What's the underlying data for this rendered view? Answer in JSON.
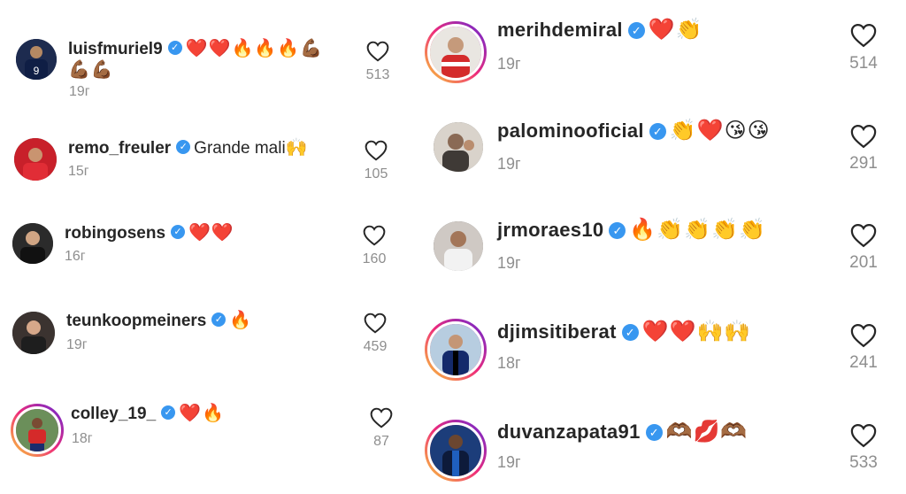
{
  "left_comments": [
    {
      "username": "luisfmuriel9",
      "text": "",
      "emojis": "❤️❤️🔥🔥🔥💪🏾",
      "emojis2": "💪🏾💪🏾",
      "time": "19г",
      "likes": "513"
    },
    {
      "username": "remo_freuler",
      "text": "Grande mali",
      "emojis": "🙌",
      "time": "15г",
      "likes": "105"
    },
    {
      "username": "robingosens",
      "text": "",
      "emojis": "❤️❤️",
      "time": "16г",
      "likes": "160"
    },
    {
      "username": "teunkoopmeiners",
      "text": "",
      "emojis": "🔥",
      "time": "19г",
      "likes": "459"
    },
    {
      "username": "colley_19_",
      "text": "",
      "emojis": "❤️🔥",
      "time": "18г",
      "likes": "87"
    }
  ],
  "right_comments": [
    {
      "username": "merihdemiral",
      "emojis": "❤️👏",
      "time": "19г",
      "likes": "514"
    },
    {
      "username": "palominooficial",
      "emojis": "👏❤️😘😘",
      "time": "19г",
      "likes": "291"
    },
    {
      "username": "jrmoraes10",
      "emojis": "🔥👏👏👏👏",
      "time": "19г",
      "likes": "201"
    },
    {
      "username": "djimsitiberat",
      "emojis": "❤️❤️🙌🙌",
      "time": "18г",
      "likes": "241"
    },
    {
      "username": "duvanzapata91",
      "emojis": "🫶🏾💋🫶🏾",
      "time": "19г",
      "likes": "533"
    }
  ],
  "icons": {
    "verified": "verified-badge-icon",
    "like": "heart-outline-icon"
  },
  "colors": {
    "verified": "#3897f0",
    "meta_text": "#8e8e8e",
    "username": "#262626"
  }
}
